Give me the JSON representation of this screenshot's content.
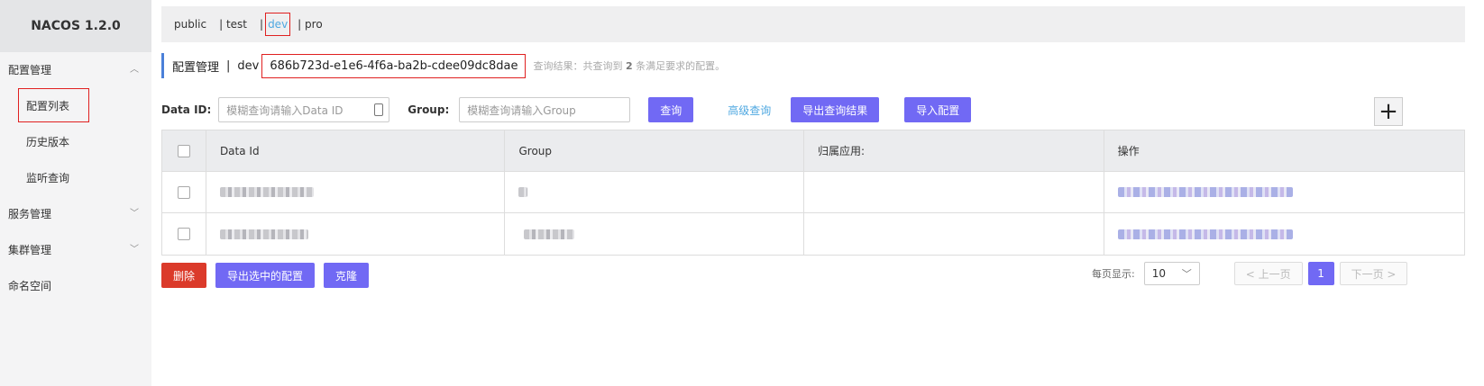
{
  "app": {
    "title": "NACOS 1.2.0"
  },
  "sidebar": {
    "groups": [
      {
        "label": "配置管理",
        "chevron": "︿",
        "items": [
          "配置列表",
          "历史版本",
          "监听查询"
        ]
      },
      {
        "label": "服务管理",
        "chevron": "﹀"
      },
      {
        "label": "集群管理",
        "chevron": "﹀"
      },
      {
        "label": "命名空间"
      }
    ]
  },
  "namespaces": {
    "items": [
      "public",
      "| test",
      "|",
      "dev",
      "| pro"
    ],
    "active": "dev"
  },
  "header": {
    "title": "配置管理",
    "separator": "|",
    "namespace": "dev",
    "namespace_id": "686b723d-e1e6-4f6a-ba2b-cdee09dc8dae",
    "result_prefix": "查询结果：共查询到",
    "result_count": "2",
    "result_suffix": "条满足要求的配置。"
  },
  "search": {
    "dataid_label": "Data ID:",
    "dataid_placeholder": "模糊查询请输入Data ID",
    "group_label": "Group:",
    "group_placeholder": "模糊查询请输入Group",
    "query_button": "查询",
    "advanced_link": "高级查询",
    "export_button": "导出查询结果",
    "import_button": "导入配置",
    "add_button": "+"
  },
  "table": {
    "columns": [
      "Data Id",
      "Group",
      "归属应用:",
      "操作"
    ]
  },
  "footer": {
    "delete_button": "删除",
    "export_selected_button": "导出选中的配置",
    "clone_button": "克隆",
    "page_size_label": "每页显示:",
    "page_size": "10",
    "prev": "< 上一页",
    "current_page": "1",
    "next": "下一页 >"
  },
  "colors": {
    "accent": "#7169f4",
    "danger": "#db3a2a",
    "link": "#4fa8e1",
    "highlight_box": "#e02020"
  }
}
